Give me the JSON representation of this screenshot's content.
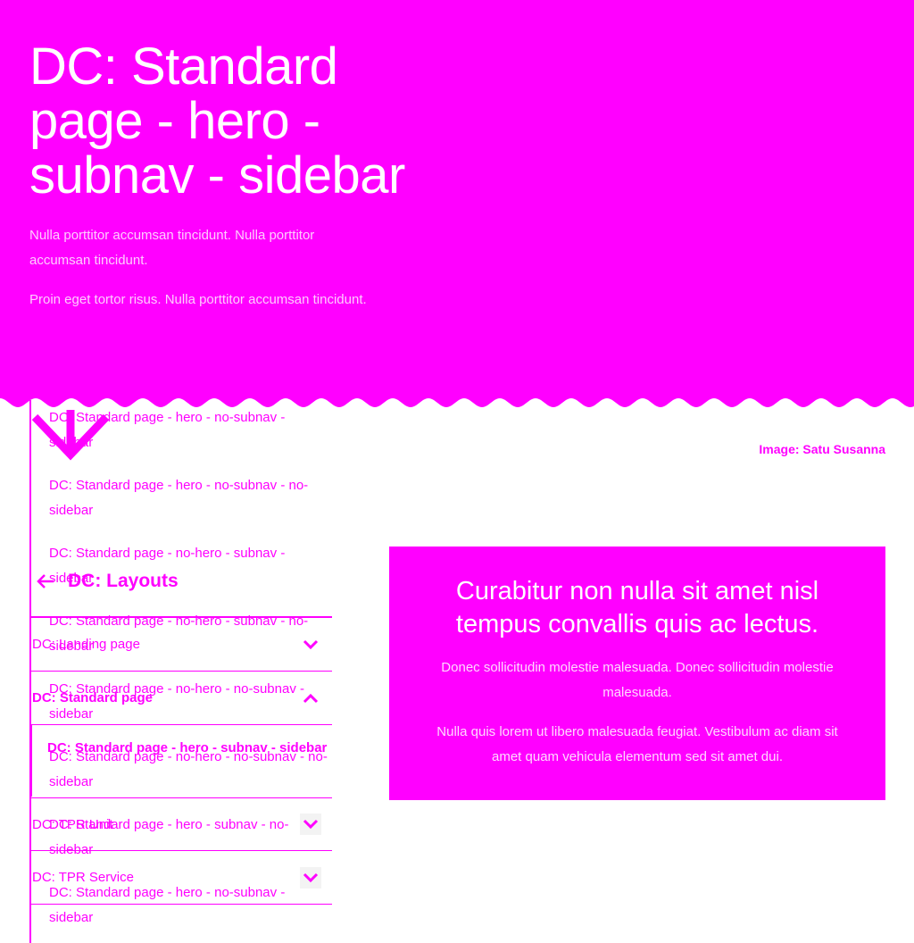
{
  "hero": {
    "title": "DC: Standard page - hero - subnav - sidebar",
    "paragraphs": [
      "Nulla porttitor accumsan tincidunt. Nulla porttitor accumsan tincidunt.",
      "Proin eget tortor risus. Nulla porttitor accumsan tincidunt."
    ],
    "image_credit": "Image: Satu Susanna"
  },
  "dropdown_pages": [
    "DC: Standard page - hero - no-subnav - sidebar",
    "DC: Standard page - hero - no-subnav - no-sidebar",
    "DC: Standard page - no-hero - subnav - sidebar",
    "DC: Standard page - no-hero - subnav - no-sidebar",
    "DC: Standard page - no-hero - no-subnav - sidebar",
    "DC: Standard page - no-hero - no-subnav - no-sidebar",
    "DC: Standard page - hero - subnav - no-sidebar",
    "DC: Standard page - hero - no-subnav - sidebar"
  ],
  "subnav": {
    "back_label": "DC: Layouts",
    "items": [
      {
        "label": "DC: Landing page",
        "state": "collapsed"
      },
      {
        "label": "DC: Standard page",
        "state": "expanded"
      },
      {
        "label": "DC: TPR Unit",
        "state": "collapsed"
      },
      {
        "label": "DC: TPR Service",
        "state": "collapsed"
      }
    ],
    "active_child": "DC: Standard page - hero - subnav - sidebar"
  },
  "callout": {
    "title": "Curabitur non nulla sit amet nisl tempus convallis quis ac lectus.",
    "paragraphs": [
      "Donec sollicitudin molestie malesuada. Donec sollicitudin molestie malesuada.",
      "Nulla quis lorem ut libero malesuada feugiat. Vestibulum ac diam sit amet quam vehicula elementum sed sit amet dui."
    ]
  },
  "colors": {
    "accent": "#ff00ff",
    "text_on_accent": "#ffffff",
    "background": "#ffffff"
  }
}
